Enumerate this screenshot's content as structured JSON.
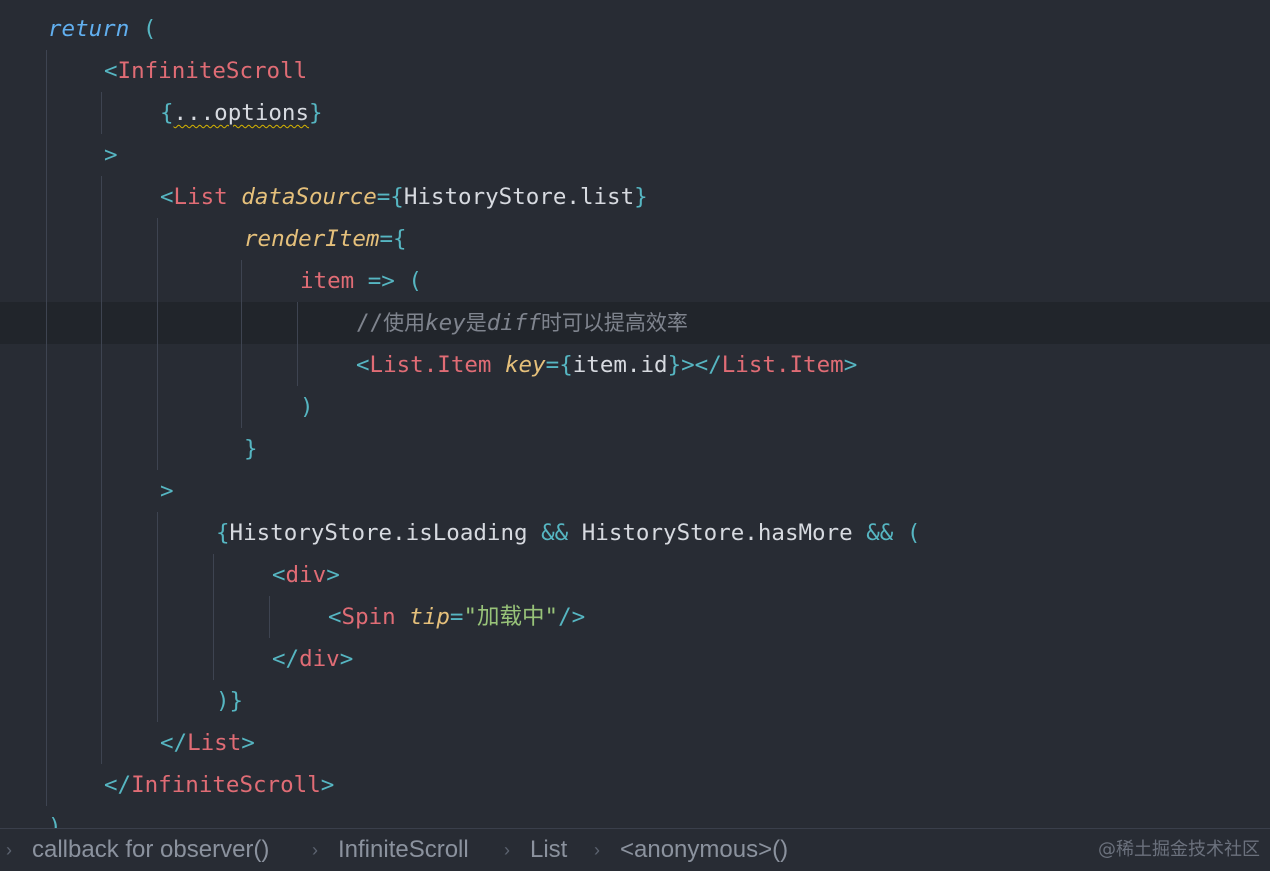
{
  "editor": {
    "theme": {
      "background": "#282c34",
      "active_line": "#21252b",
      "tag": "#e06c75",
      "attr": "#e5c07b",
      "punct": "#56b6c2",
      "string": "#98c379",
      "comment": "#7f848e"
    },
    "lines": {
      "l1": {
        "return_kw": "return",
        "paren": " ("
      },
      "l2": {
        "open": "<",
        "tag": "InfiniteScroll"
      },
      "l3": {
        "open": "{",
        "body": "...options",
        "close": "}"
      },
      "l4": {
        "gt": ">"
      },
      "l5": {
        "open": "<",
        "tag": "List",
        "attr": "dataSource",
        "eq": "={",
        "value": "HistoryStore.list",
        "close": "}"
      },
      "l6": {
        "attr": "renderItem",
        "eq": "={"
      },
      "l7": {
        "param": "item",
        "arrow": " => ("
      },
      "l8": {
        "slashes": "//",
        "t1": "使用",
        "key": "key",
        "t2": "是",
        "diff": "diff",
        "t3": "时可以提高效率"
      },
      "l9": {
        "open": "<",
        "tag": "List.Item",
        "attr": "key",
        "eq": "={",
        "value": "item.id",
        "close": "}></",
        "tag2": "List.Item",
        "gt": ">"
      },
      "l10": {
        "paren": ")"
      },
      "l11": {
        "brace": "}"
      },
      "l12": {
        "gt": ">"
      },
      "l13": {
        "open": "{",
        "a": "HistoryStore.isLoading",
        "and1": " && ",
        "b": "HistoryStore.hasMore",
        "and2": " && ("
      },
      "l14": {
        "open": "<",
        "tag": "div",
        "gt": ">"
      },
      "l15": {
        "open": "<",
        "tag": "Spin",
        "attr": "tip",
        "eq": "=",
        "value": "\"加载中\"",
        "close": "/>"
      },
      "l16": {
        "open": "</",
        "tag": "div",
        "gt": ">"
      },
      "l17": {
        "close": ")}"
      },
      "l18": {
        "open": "</",
        "tag": "List",
        "gt": ">"
      },
      "l19": {
        "open": "</",
        "tag": "InfiniteScroll",
        "gt": ">"
      },
      "l20": {
        "paren": ")"
      }
    }
  },
  "breadcrumb": {
    "chevron": "›",
    "items": [
      "callback for observer()",
      "InfiniteScroll",
      "List",
      "<anonymous>()"
    ]
  },
  "watermark": "@稀土掘金技术社区"
}
